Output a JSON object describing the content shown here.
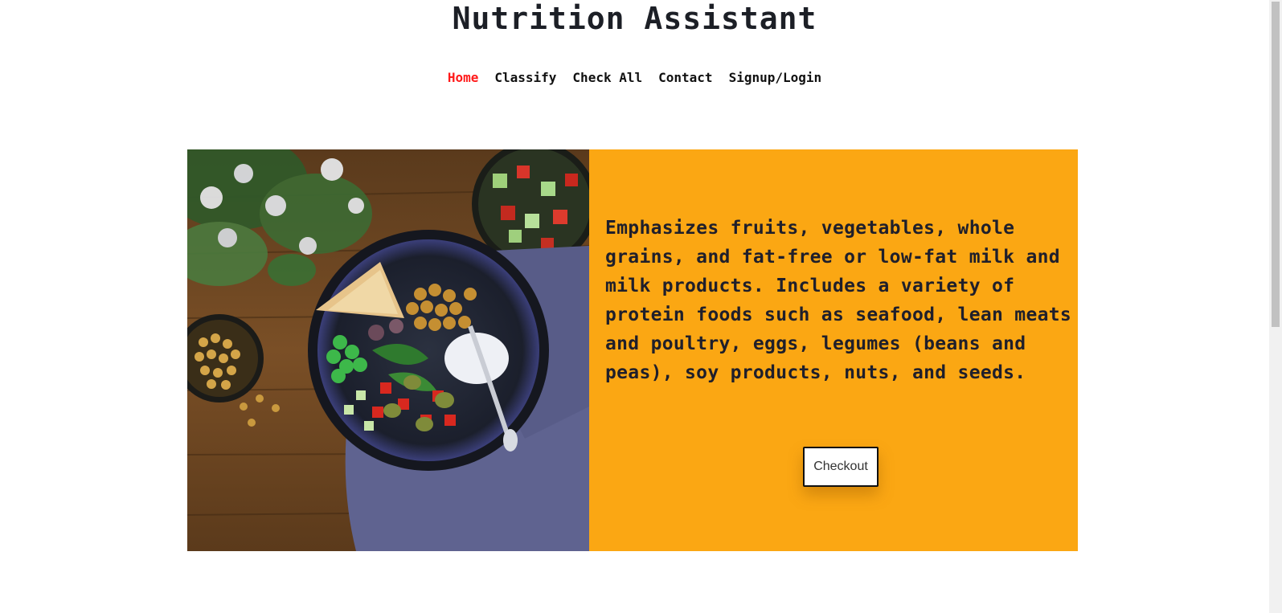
{
  "header": {
    "title": "Nutrition Assistant"
  },
  "nav": {
    "items": [
      {
        "label": "Home",
        "active": true
      },
      {
        "label": "Classify",
        "active": false
      },
      {
        "label": "Check All",
        "active": false
      },
      {
        "label": "Contact",
        "active": false
      },
      {
        "label": "Signup/Login",
        "active": false
      }
    ]
  },
  "hero": {
    "image": "salad-bowl-photo",
    "text": "Emphasizes fruits, vegetables, whole grains, and fat-free or low-fat milk and milk products. Includes a variety of protein foods such as seafood, lean meats and poultry, eggs, legumes (beans and peas), soy products, nuts, and seeds.",
    "button_label": "Checkout"
  },
  "colors": {
    "accent": "#fba713",
    "active_nav": "#ff1a1a",
    "title": "#1c1f26"
  }
}
